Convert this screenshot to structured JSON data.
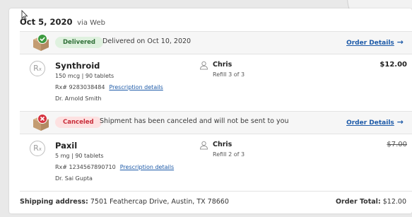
{
  "order": {
    "date": "Oct 5, 2020",
    "via": "via Web"
  },
  "shipments": [
    {
      "status": "Delivered",
      "status_text": "Delivered on Oct 10, 2020",
      "order_link": "Order Details",
      "status_color": "#2f6f37",
      "item": {
        "name": "Synthroid",
        "dose": "150 mcg",
        "qty": "90 tablets",
        "rx": "Rx# 9283038484",
        "rx_link": "Prescription details",
        "doctor": "Dr. Arnold Smith",
        "patient": "Chris",
        "refill": "Refill 3 of 3",
        "price": "$12.00"
      }
    },
    {
      "status": "Canceled",
      "status_text": "Shipment has been canceled and will not be sent to you",
      "order_link": "Order Details",
      "status_color": "#c92d3a",
      "item": {
        "name": "Paxil",
        "dose": "5 mg",
        "qty": "90 tablets",
        "rx": "Rx# 1234567890710",
        "rx_link": "Prescription details",
        "doctor": "Dr. Sai Gupta",
        "patient": "Chris",
        "refill": "Refill 2 of 3",
        "price": "$7.00"
      }
    }
  ],
  "footer": {
    "shipping_label": "Shipping address:",
    "shipping_address": "7501 Feathercap Drive, Austin, TX 78660",
    "total_label": "Order Total:",
    "total_value": "$12.00"
  },
  "icons": {
    "box_delivered": "package-check-icon",
    "box_canceled": "package-x-icon",
    "rx": "rx-icon",
    "person": "person-icon",
    "arrow": "arrow-right-icon"
  },
  "separator": "|"
}
